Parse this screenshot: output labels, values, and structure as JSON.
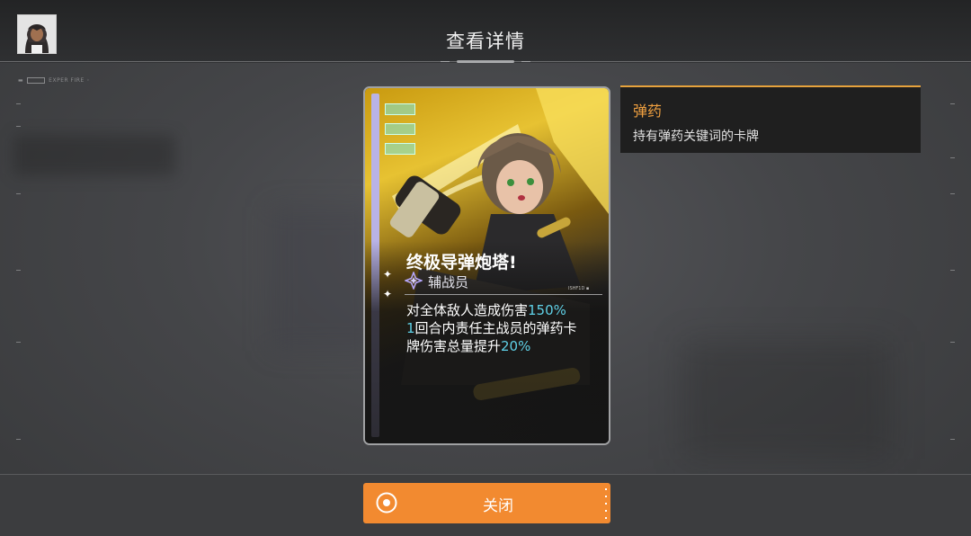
{
  "header": {
    "title": "查看详情",
    "hud_label": "EXPER FIRE"
  },
  "card": {
    "name": "终极导弹炮塔!",
    "type": "辅战员",
    "code": "ISHF1D ▪",
    "desc_line1_pre": "对全体敌人造成伤害",
    "desc_line1_val": "150%",
    "desc_line2_val": "1",
    "desc_line2_post": "回合内责任主战员的弹药卡",
    "desc_line3_pre": "牌伤害总量提升",
    "desc_line3_val": "20%"
  },
  "tooltip": {
    "title": "弹药",
    "text": "持有弹药关键词的卡牌"
  },
  "footer": {
    "close_label": "关闭"
  },
  "colors": {
    "accent": "#f28a30",
    "highlight": "#5fd0e6",
    "tip_title": "#f0a040",
    "card_strip": "#b9b3e6"
  },
  "icons": {
    "avatar": "character-portrait",
    "card_type": "support-star-icon",
    "close": "target-circle-icon"
  }
}
